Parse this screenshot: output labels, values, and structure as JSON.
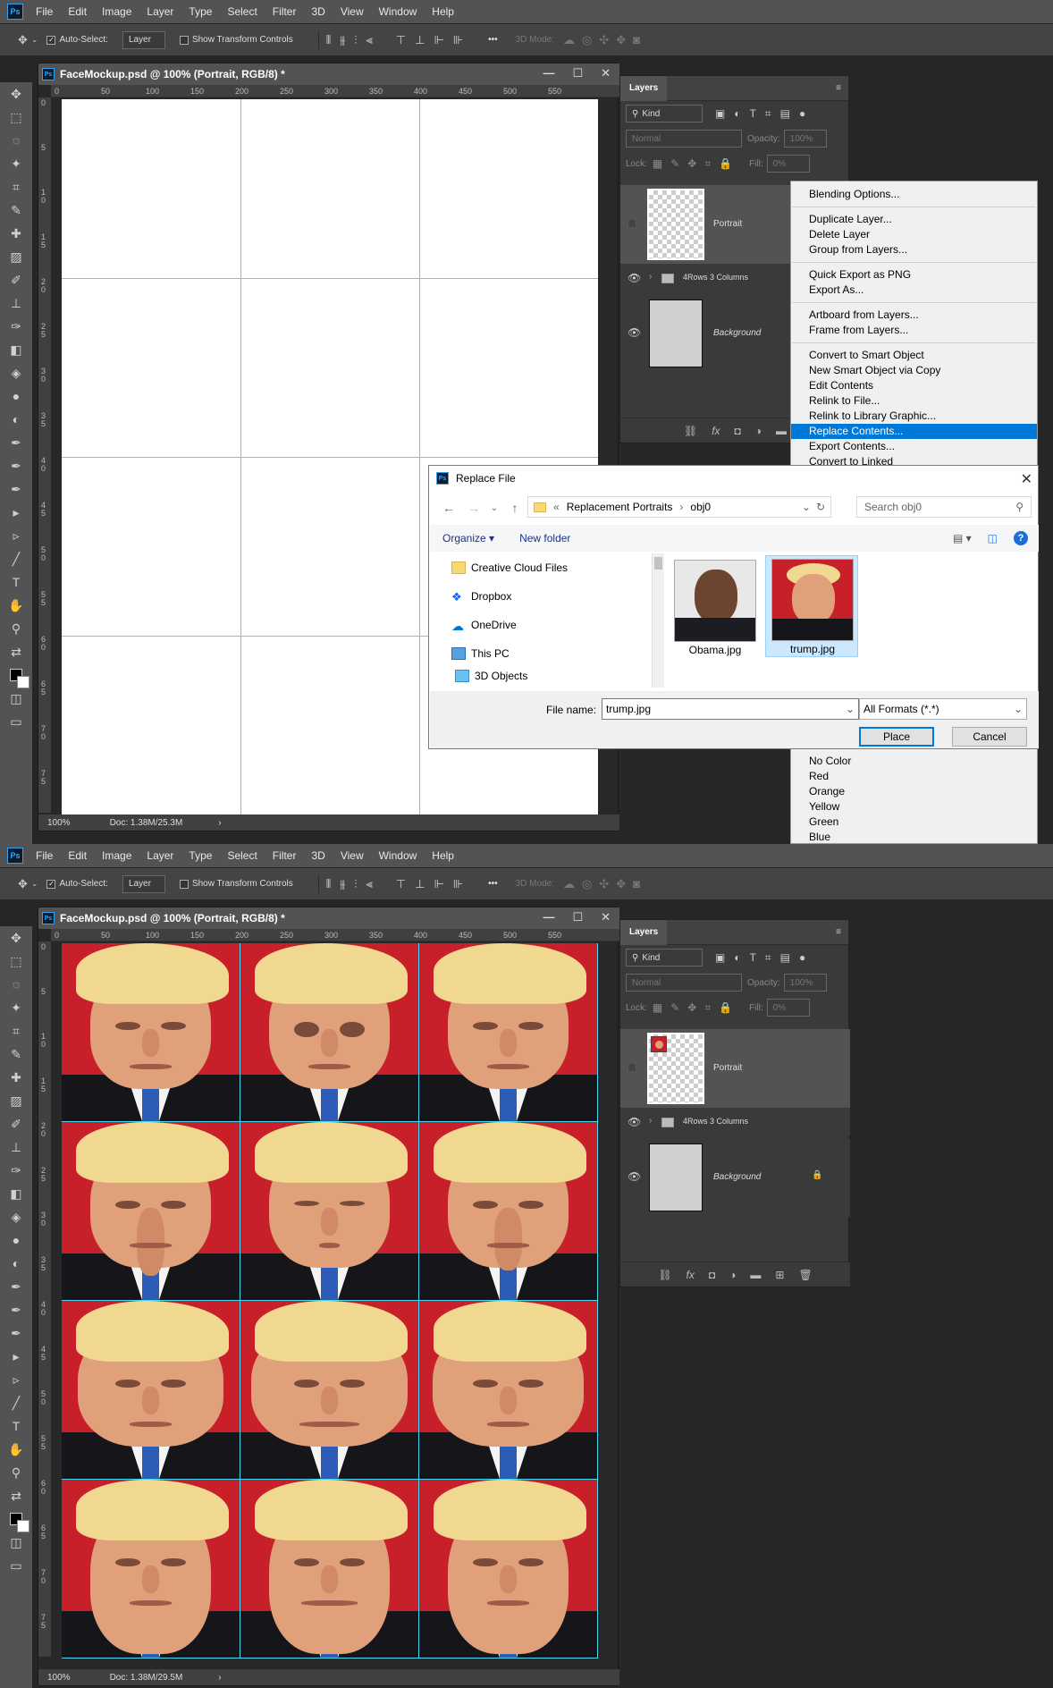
{
  "menu": [
    "File",
    "Edit",
    "Image",
    "Layer",
    "Type",
    "Select",
    "Filter",
    "3D",
    "View",
    "Window",
    "Help"
  ],
  "ps_logo": "Ps",
  "options": {
    "auto_select": "Auto-Select:",
    "layer_select": "Layer",
    "show_transform": "Show Transform Controls",
    "mode_3d": "3D Mode:",
    "more": "•••"
  },
  "document": {
    "title": "FaceMockup.psd @ 100% (Portrait, RGB/8) *",
    "zoom": "100%",
    "doc_size_top": "Doc: 1.38M/25.3M",
    "doc_size_bottom": "Doc: 1.38M/29.5M",
    "ruler_h": [
      "0",
      "50",
      "100",
      "150",
      "200",
      "250",
      "300",
      "350",
      "400",
      "450",
      "500",
      "550"
    ],
    "ruler_v": [
      "0",
      "5",
      "1\n0",
      "1\n5",
      "2\n0",
      "2\n5",
      "3\n0",
      "3\n5",
      "4\n0",
      "4\n5",
      "5\n0",
      "5\n5",
      "6\n0",
      "6\n5",
      "7\n0",
      "7\n5"
    ]
  },
  "layers_panel": {
    "tab": "Layers",
    "kind": "Kind",
    "blend": "Normal",
    "opacity_label": "Opacity:",
    "opacity_value": "100%",
    "lock_label": "Lock:",
    "fill_label": "Fill:",
    "fill_value": "0%",
    "layers": [
      {
        "name": "Portrait"
      },
      {
        "name": "4Rows 3 Columns"
      },
      {
        "name": "Background"
      }
    ]
  },
  "context_menu": {
    "groups": [
      [
        "Blending Options..."
      ],
      [
        "Duplicate Layer...",
        "Delete Layer",
        "Group from Layers..."
      ],
      [
        "Quick Export as PNG",
        "Export As..."
      ],
      [
        "Artboard from Layers...",
        "Frame from Layers..."
      ],
      [
        "Convert to Smart Object",
        "New Smart Object via Copy",
        "Edit Contents",
        "Relink to File...",
        "Relink to Library Graphic...",
        "Replace Contents...",
        "Export Contents...",
        "Convert to Linked"
      ]
    ],
    "highlighted": "Replace Contents...",
    "colors": [
      "No Color",
      "Red",
      "Orange",
      "Yellow",
      "Green",
      "Blue"
    ]
  },
  "dialog": {
    "title": "Replace File",
    "path": [
      "Replacement Portraits",
      "obj0"
    ],
    "search_placeholder": "Search obj0",
    "organize": "Organize",
    "new_folder": "New folder",
    "nav": [
      "Creative Cloud Files",
      "Dropbox",
      "OneDrive",
      "This PC",
      "3D Objects"
    ],
    "files": [
      "Obama.jpg",
      "trump.jpg"
    ],
    "file_name_label": "File name:",
    "file_name": "trump.jpg",
    "filter": "All Formats (*.*)",
    "place": "Place",
    "cancel": "Cancel"
  },
  "colors": {
    "accent": "#0078d7",
    "guide": "#4dd6ef",
    "ps_blue": "#31a8ff"
  }
}
